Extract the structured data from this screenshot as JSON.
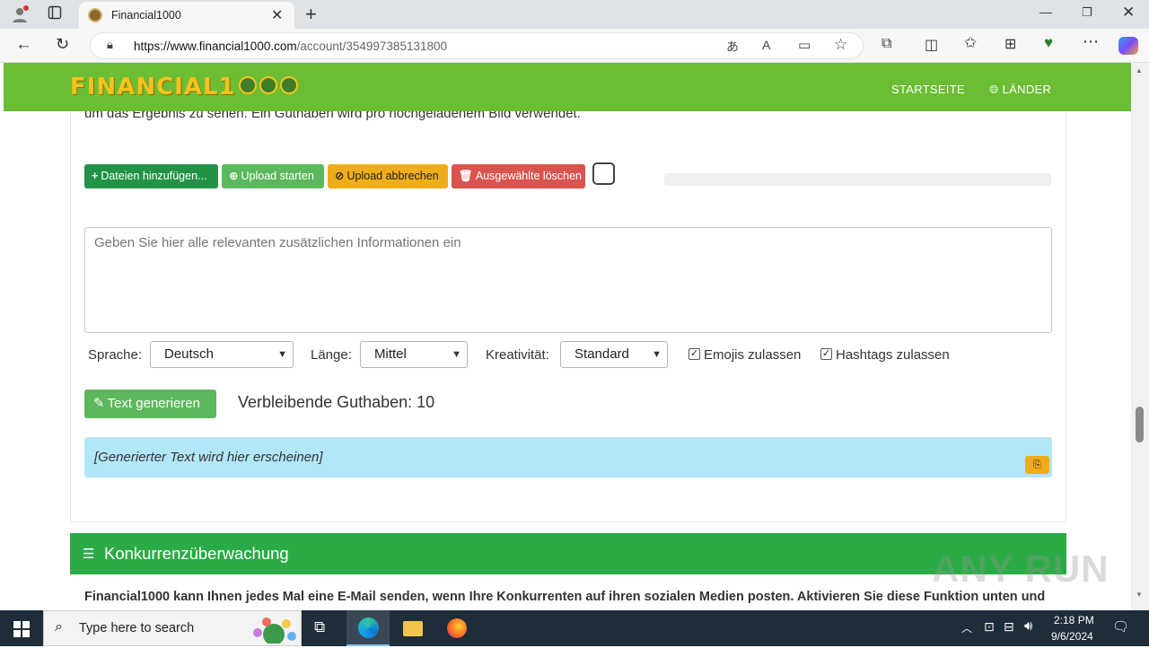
{
  "browser": {
    "tab_title": "Financial1000",
    "url_host": "https://www.financial1000.com",
    "url_path": "/account/354997385131800"
  },
  "site": {
    "logo_text": "FINANCIAL1",
    "nav": {
      "home": "STARTSEITE",
      "countries": "LÄNDER"
    }
  },
  "upload": {
    "intro_text": "um das Ergebnis zu sehen. Ein Guthaben wird pro hochgeladenem Bild verwendet.",
    "add_files": "Dateien hinzufügen...",
    "start_upload": "Upload starten",
    "cancel_upload": "Upload abbrechen",
    "delete_selected": "Ausgewählte löschen"
  },
  "form": {
    "info_placeholder": "Geben Sie hier alle relevanten zusätzlichen Informationen ein",
    "language_label": "Sprache:",
    "language_value": "Deutsch",
    "length_label": "Länge:",
    "length_value": "Mittel",
    "creativity_label": "Kreativität:",
    "creativity_value": "Standard",
    "emojis_label": "Emojis zulassen",
    "emojis_checked": true,
    "hashtags_label": "Hashtags zulassen",
    "hashtags_checked": true,
    "generate_button": "Text generieren",
    "credits_text": "Verbleibende Guthaben: 10",
    "result_placeholder": "[Generierter Text wird hier erscheinen]"
  },
  "competitor": {
    "title": "Konkurrenzüberwachung",
    "description": "Financial1000 kann Ihnen jedes Mal eine E-Mail senden, wenn Ihre Konkurrenten auf ihren sozialen Medien posten. Aktivieren Sie diese Funktion unten und"
  },
  "taskbar": {
    "search_placeholder": "Type here to search",
    "time": "2:18 PM",
    "date": "9/6/2024"
  },
  "watermark": "ANY RUN",
  "colors": {
    "nav_green": "#6bbd34",
    "btn_green": "#229345",
    "btn_lightgreen": "#5cb85c",
    "btn_yellow": "#f0ad1a",
    "btn_red": "#d9534f",
    "result_blue": "#b2e6f9",
    "panel_green": "#2bab45"
  }
}
